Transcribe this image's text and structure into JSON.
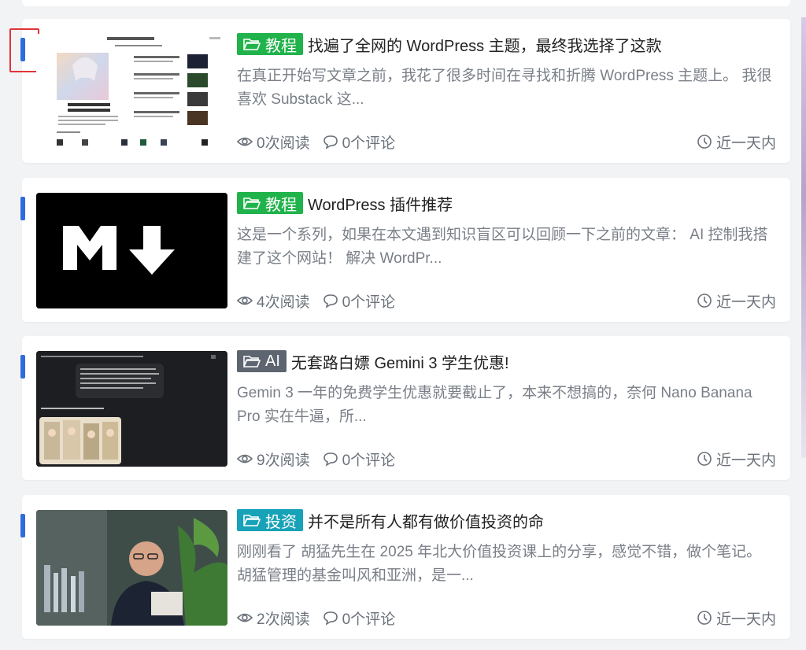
{
  "colors": {
    "accent": "#2f6bdd",
    "tag_tutorial": "#21b34b",
    "tag_ai": "#5d6570",
    "tag_invest": "#18a2b8"
  },
  "posts": [
    {
      "tag": "教程",
      "title": "找遍了全网的 WordPress 主题，最终我选择了这款",
      "excerpt": "在真正开始写文章之前，我花了很多时间在寻找和折腾 WordPress 主题上。 我很喜欢 Substack 这...",
      "views": "0次阅读",
      "comments": "0个评论",
      "time": "近一天内",
      "thumb_icon": "theme-screenshot"
    },
    {
      "tag": "教程",
      "title": "WordPress 插件推荐",
      "excerpt": "这是一个系列，如果在本文遇到知识盲区可以回顾一下之前的文章： AI 控制我搭建了这个网站！ 解决 WordPr...",
      "views": "4次阅读",
      "comments": "0个评论",
      "time": "近一天内",
      "thumb_icon": "markdown-logo"
    },
    {
      "tag": "AI",
      "title": "无套路白嫖 Gemini 3 学生优惠!",
      "excerpt": "Gemin 3 一年的免费学生优惠就要截止了，本来不想搞的，奈何 Nano Banana Pro 实在牛逼，所...",
      "views": "9次阅读",
      "comments": "0个评论",
      "time": "近一天内",
      "thumb_icon": "gemini-chat-screenshot"
    },
    {
      "tag": "投资",
      "title": "并不是所有人都有做价值投资的命",
      "excerpt": "刚刚看了 胡猛先生在 2025 年北大价值投资课上的分享，感觉不错，做个笔记。 胡猛管理的基金叫风和亚洲，是一...",
      "views": "2次阅读",
      "comments": "0个评论",
      "time": "近一天内",
      "thumb_icon": "portrait-photo"
    }
  ]
}
